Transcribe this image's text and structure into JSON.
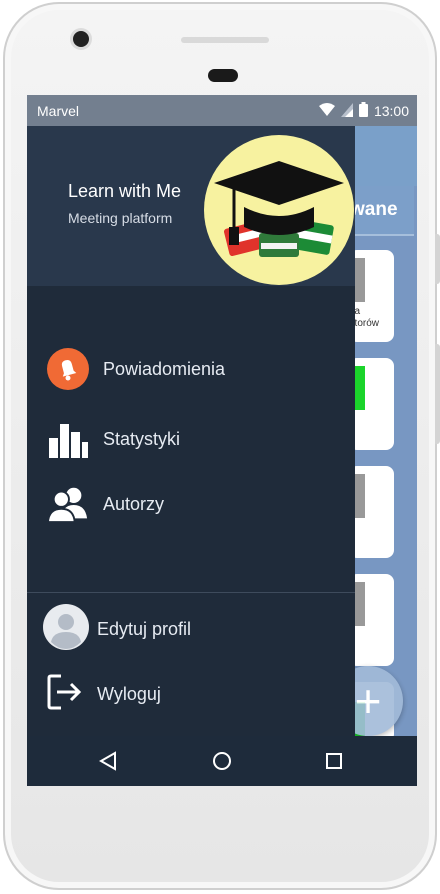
{
  "status": {
    "carrier": "Marvel",
    "time": "13:00"
  },
  "drawer": {
    "title": "Learn with Me",
    "subtitle": "Meeting platform",
    "menu": [
      {
        "label": "Powiadomienia",
        "icon": "bell-icon"
      },
      {
        "label": "Statystyki",
        "icon": "bar-chart-icon"
      },
      {
        "label": "Autorzy",
        "icon": "people-icon"
      }
    ],
    "bottom": [
      {
        "label": "Edytuj profil",
        "icon": "avatar-icon"
      },
      {
        "label": "Wyloguj",
        "icon": "logout-icon"
      }
    ]
  },
  "background": {
    "tab_label": "wane",
    "card_text": [
      "ba",
      "atorów"
    ]
  },
  "colors": {
    "drawer_bg": "#1f2b3a",
    "drawer_header": "#29384c",
    "accent_orange": "#f06a35",
    "logo_bg": "#f7f2a0"
  }
}
